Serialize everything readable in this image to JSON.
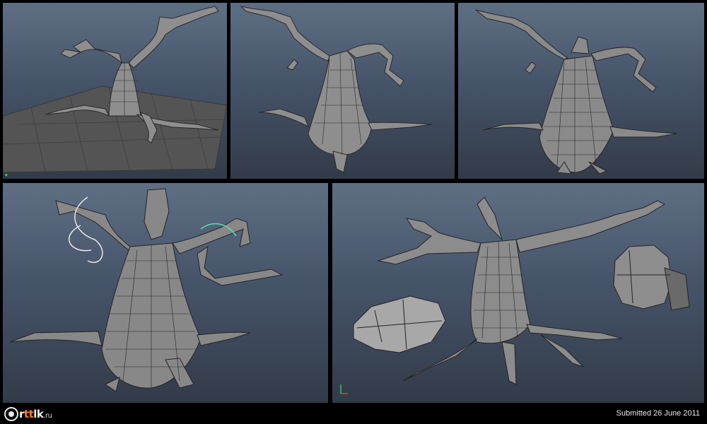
{
  "footer": {
    "logo_prefix": "r",
    "logo_accent": "tt",
    "logo_suffix": "lk",
    "logo_tld": ".ru",
    "submitted": "Submitted 26 June 2011"
  },
  "colors": {
    "viewport_top": "#5e6f84",
    "viewport_bottom": "#323b48",
    "mesh_fill": "#8e8e8e",
    "mesh_wire": "#2a2a2a",
    "logo_accent": "#ff7a1a"
  }
}
